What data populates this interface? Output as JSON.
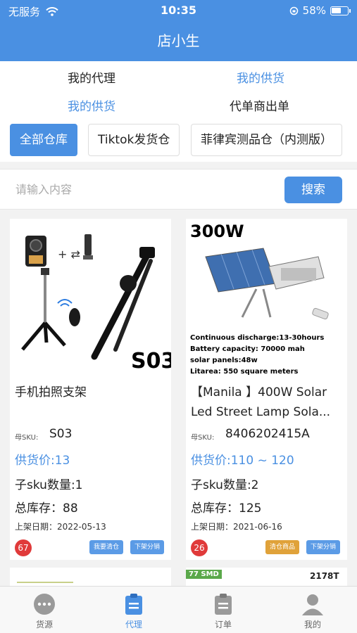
{
  "status_bar": {
    "carrier": "无服务",
    "time": "10:35",
    "battery": "58%"
  },
  "nav": {
    "title": "店小生"
  },
  "menu": {
    "my_agency": "我的代理",
    "my_supply_top": "我的供货",
    "my_supply": "我的供货",
    "agent_order": "代单商出单"
  },
  "warehouses": [
    "全部仓库",
    "Tiktok发货仓",
    "菲律宾测品仓（内测版）"
  ],
  "search": {
    "placeholder": "请输入内容",
    "button": "搜索"
  },
  "products": [
    {
      "title": "手机拍照支架",
      "sku_label": "母SKU:",
      "sku": "S03",
      "price": "供货价:13",
      "sub_sku": "子sku数量:1",
      "stock": "总库存：88",
      "date": "上架日期：2022-05-13",
      "badge": "67",
      "image_text": "S03",
      "buttons": [
        {
          "label": "我要清仓",
          "color": "#5b9be6"
        },
        {
          "label": "下架分销",
          "color": "#5b9be6"
        }
      ]
    },
    {
      "title": "【Manila 】400W Solar Led Street Lamp Sola...",
      "sku_label": "母SKU:",
      "sku": "8406202415A",
      "price": "供货价:110 ~ 120",
      "sub_sku": "子sku数量:2",
      "stock": "总库存：125",
      "date": "上架日期：2021-06-16",
      "badge": "26",
      "image_text": {
        "headline": "300W",
        "line1": "Continuous discharge:13-30hours",
        "line2": "Battery capacity: 70000 mah",
        "line3": "solar panels:48w",
        "line4": "Litarea:  550 square meters"
      },
      "buttons": [
        {
          "label": "清仓商品",
          "color": "#e0a23a"
        },
        {
          "label": "下架分销",
          "color": "#5b9be6"
        }
      ]
    }
  ],
  "peek": {
    "right_tag": "77 SMD",
    "right_code": "2178T"
  },
  "tabbar": [
    {
      "label": "货源",
      "icon": "chat-bubble-icon"
    },
    {
      "label": "代理",
      "icon": "clipboard-icon"
    },
    {
      "label": "订单",
      "icon": "order-doc-icon"
    },
    {
      "label": "我的",
      "icon": "person-icon"
    }
  ],
  "colors": {
    "primary": "#4a90e2",
    "badge": "#e03a3a",
    "clearance": "#e0a23a"
  }
}
